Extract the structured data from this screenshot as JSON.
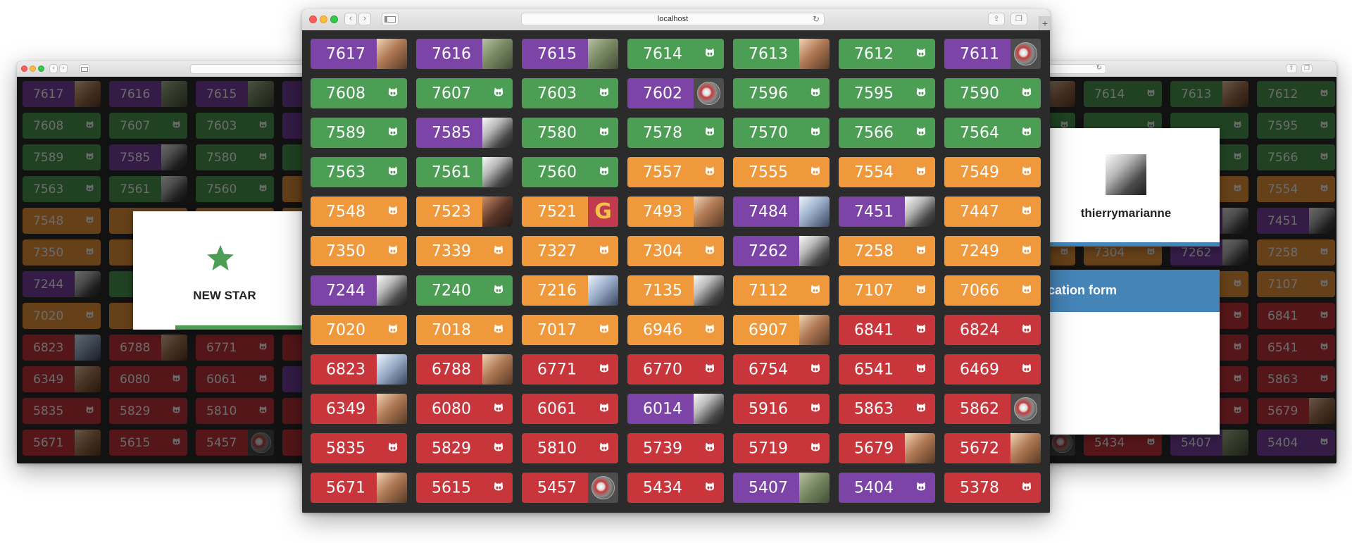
{
  "browser": {
    "url": "localhost"
  },
  "main_cards": [
    {
      "n": "7617",
      "c": "draft",
      "a": "f"
    },
    {
      "n": "7616",
      "c": "draft",
      "a": "g"
    },
    {
      "n": "7615",
      "c": "draft",
      "a": "g"
    },
    {
      "n": "7614",
      "c": "merged"
    },
    {
      "n": "7613",
      "c": "merged",
      "a": "f"
    },
    {
      "n": "7612",
      "c": "merged"
    },
    {
      "n": "7611",
      "c": "draft",
      "a": "r"
    },
    {
      "n": "7608",
      "c": "merged"
    },
    {
      "n": "7607",
      "c": "merged"
    },
    {
      "n": "7603",
      "c": "merged"
    },
    {
      "n": "7602",
      "c": "draft",
      "a": "r"
    },
    {
      "n": "7596",
      "c": "merged"
    },
    {
      "n": "7595",
      "c": "merged"
    },
    {
      "n": "7590",
      "c": "merged"
    },
    {
      "n": "7589",
      "c": "merged"
    },
    {
      "n": "7585",
      "c": "draft",
      "a": "b"
    },
    {
      "n": "7580",
      "c": "merged"
    },
    {
      "n": "7578",
      "c": "merged"
    },
    {
      "n": "7570",
      "c": "merged"
    },
    {
      "n": "7566",
      "c": "merged"
    },
    {
      "n": "7564",
      "c": "merged"
    },
    {
      "n": "7563",
      "c": "merged"
    },
    {
      "n": "7561",
      "c": "merged",
      "a": "b"
    },
    {
      "n": "7560",
      "c": "merged"
    },
    {
      "n": "7557",
      "c": "open"
    },
    {
      "n": "7555",
      "c": "open"
    },
    {
      "n": "7554",
      "c": "open"
    },
    {
      "n": "7549",
      "c": "open"
    },
    {
      "n": "7548",
      "c": "open"
    },
    {
      "n": "7523",
      "c": "open",
      "a": "k"
    },
    {
      "n": "7521",
      "c": "open",
      "a": "gg"
    },
    {
      "n": "7493",
      "c": "open",
      "a": "f"
    },
    {
      "n": "7484",
      "c": "draft",
      "a": "l"
    },
    {
      "n": "7451",
      "c": "draft",
      "a": "b"
    },
    {
      "n": "7447",
      "c": "open"
    },
    {
      "n": "7350",
      "c": "open"
    },
    {
      "n": "7339",
      "c": "open"
    },
    {
      "n": "7327",
      "c": "open"
    },
    {
      "n": "7304",
      "c": "open"
    },
    {
      "n": "7262",
      "c": "draft",
      "a": "b"
    },
    {
      "n": "7258",
      "c": "open"
    },
    {
      "n": "7249",
      "c": "open"
    },
    {
      "n": "7244",
      "c": "draft",
      "a": "b"
    },
    {
      "n": "7240",
      "c": "merged"
    },
    {
      "n": "7216",
      "c": "open",
      "a": "l"
    },
    {
      "n": "7135",
      "c": "open",
      "a": "b"
    },
    {
      "n": "7112",
      "c": "open"
    },
    {
      "n": "7107",
      "c": "open"
    },
    {
      "n": "7066",
      "c": "open"
    },
    {
      "n": "7020",
      "c": "open"
    },
    {
      "n": "7018",
      "c": "open"
    },
    {
      "n": "7017",
      "c": "open"
    },
    {
      "n": "6946",
      "c": "open"
    },
    {
      "n": "6907",
      "c": "open",
      "a": "f"
    },
    {
      "n": "6841",
      "c": "closed"
    },
    {
      "n": "6824",
      "c": "closed"
    },
    {
      "n": "6823",
      "c": "closed",
      "a": "l"
    },
    {
      "n": "6788",
      "c": "closed",
      "a": "f"
    },
    {
      "n": "6771",
      "c": "closed"
    },
    {
      "n": "6770",
      "c": "closed"
    },
    {
      "n": "6754",
      "c": "closed"
    },
    {
      "n": "6541",
      "c": "closed"
    },
    {
      "n": "6469",
      "c": "closed"
    },
    {
      "n": "6349",
      "c": "closed",
      "a": "f"
    },
    {
      "n": "6080",
      "c": "closed"
    },
    {
      "n": "6061",
      "c": "closed"
    },
    {
      "n": "6014",
      "c": "draft",
      "a": "b"
    },
    {
      "n": "5916",
      "c": "closed"
    },
    {
      "n": "5863",
      "c": "closed"
    },
    {
      "n": "5862",
      "c": "closed",
      "a": "r"
    },
    {
      "n": "5835",
      "c": "closed"
    },
    {
      "n": "5829",
      "c": "closed"
    },
    {
      "n": "5810",
      "c": "closed"
    },
    {
      "n": "5739",
      "c": "closed"
    },
    {
      "n": "5719",
      "c": "closed"
    },
    {
      "n": "5679",
      "c": "closed",
      "a": "f"
    },
    {
      "n": "5672",
      "c": "closed",
      "a": "f"
    },
    {
      "n": "5671",
      "c": "closed",
      "a": "f"
    },
    {
      "n": "5615",
      "c": "closed"
    },
    {
      "n": "5457",
      "c": "closed",
      "a": "r"
    },
    {
      "n": "5434",
      "c": "closed"
    },
    {
      "n": "5407",
      "c": "draft",
      "a": "g"
    },
    {
      "n": "5404",
      "c": "draft"
    },
    {
      "n": "5378",
      "c": "closed"
    }
  ],
  "left_cards": [
    {
      "n": "7617",
      "c": "draft",
      "a": "f"
    },
    {
      "n": "7616",
      "c": "draft",
      "a": "g"
    },
    {
      "n": "7615",
      "c": "draft",
      "a": "g"
    },
    {
      "n": "",
      "c": "draft"
    },
    {
      "n": "7608",
      "c": "merged"
    },
    {
      "n": "7607",
      "c": "merged"
    },
    {
      "n": "7603",
      "c": "merged"
    },
    {
      "n": "",
      "c": "draft"
    },
    {
      "n": "7589",
      "c": "merged"
    },
    {
      "n": "7585",
      "c": "draft",
      "a": "b"
    },
    {
      "n": "7580",
      "c": "merged"
    },
    {
      "n": "",
      "c": "merged"
    },
    {
      "n": "7563",
      "c": "merged"
    },
    {
      "n": "7561",
      "c": "merged",
      "a": "b"
    },
    {
      "n": "7560",
      "c": "merged"
    },
    {
      "n": "",
      "c": "open"
    },
    {
      "n": "7548",
      "c": "open"
    },
    {
      "n": "",
      "c": "open"
    },
    {
      "n": "",
      "c": "open"
    },
    {
      "n": "",
      "c": "open"
    },
    {
      "n": "7350",
      "c": "open"
    },
    {
      "n": "",
      "c": "open"
    },
    {
      "n": "",
      "c": "open"
    },
    {
      "n": "",
      "c": "open"
    },
    {
      "n": "7244",
      "c": "draft",
      "a": "b"
    },
    {
      "n": "",
      "c": "merged"
    },
    {
      "n": "",
      "c": "open"
    },
    {
      "n": "",
      "c": "open"
    },
    {
      "n": "7020",
      "c": "open"
    },
    {
      "n": "",
      "c": "open"
    },
    {
      "n": "",
      "c": "open"
    },
    {
      "n": "",
      "c": "open"
    },
    {
      "n": "6823",
      "c": "closed",
      "a": "l"
    },
    {
      "n": "6788",
      "c": "closed",
      "a": "f"
    },
    {
      "n": "6771",
      "c": "closed"
    },
    {
      "n": "",
      "c": "closed"
    },
    {
      "n": "6349",
      "c": "closed",
      "a": "f"
    },
    {
      "n": "6080",
      "c": "closed"
    },
    {
      "n": "6061",
      "c": "closed"
    },
    {
      "n": "",
      "c": "draft"
    },
    {
      "n": "5835",
      "c": "closed"
    },
    {
      "n": "5829",
      "c": "closed"
    },
    {
      "n": "5810",
      "c": "closed"
    },
    {
      "n": "",
      "c": "closed"
    },
    {
      "n": "5671",
      "c": "closed",
      "a": "f"
    },
    {
      "n": "5615",
      "c": "closed"
    },
    {
      "n": "5457",
      "c": "closed",
      "a": "r"
    },
    {
      "n": "",
      "c": "closed"
    }
  ],
  "right_cards": [
    {
      "n": "",
      "c": "merged",
      "a": "f"
    },
    {
      "n": "7614",
      "c": "merged"
    },
    {
      "n": "7613",
      "c": "merged",
      "a": "f"
    },
    {
      "n": "7612",
      "c": "merged"
    },
    {
      "n": "",
      "c": "merged"
    },
    {
      "n": "",
      "c": "merged"
    },
    {
      "n": "",
      "c": "merged"
    },
    {
      "n": "7595",
      "c": "merged"
    },
    {
      "n": "",
      "c": "merged"
    },
    {
      "n": "",
      "c": "merged"
    },
    {
      "n": "",
      "c": "merged"
    },
    {
      "n": "7566",
      "c": "merged"
    },
    {
      "n": "",
      "c": "open"
    },
    {
      "n": "",
      "c": "open"
    },
    {
      "n": "",
      "c": "open"
    },
    {
      "n": "7554",
      "c": "open"
    },
    {
      "n": "",
      "c": "draft",
      "a": "b"
    },
    {
      "n": "",
      "c": "open"
    },
    {
      "n": "",
      "c": "draft",
      "a": "b"
    },
    {
      "n": "7451",
      "c": "draft",
      "a": "b"
    },
    {
      "n": "",
      "c": "open"
    },
    {
      "n": "7304",
      "c": "open"
    },
    {
      "n": "7262",
      "c": "draft",
      "a": "b"
    },
    {
      "n": "7258",
      "c": "open"
    },
    {
      "n": "",
      "c": "open"
    },
    {
      "n": "",
      "c": "open"
    },
    {
      "n": "",
      "c": "open"
    },
    {
      "n": "7107",
      "c": "open"
    },
    {
      "n": "",
      "c": "open",
      "a": "f"
    },
    {
      "n": "",
      "c": "closed"
    },
    {
      "n": "",
      "c": "closed"
    },
    {
      "n": "6841",
      "c": "closed"
    },
    {
      "n": "",
      "c": "closed"
    },
    {
      "n": "",
      "c": "closed"
    },
    {
      "n": "",
      "c": "closed"
    },
    {
      "n": "6541",
      "c": "closed"
    },
    {
      "n": "",
      "c": "closed",
      "a": "b"
    },
    {
      "n": "",
      "c": "closed"
    },
    {
      "n": "",
      "c": "closed"
    },
    {
      "n": "5863",
      "c": "closed"
    },
    {
      "n": "",
      "c": "closed"
    },
    {
      "n": "",
      "c": "closed"
    },
    {
      "n": "",
      "c": "closed"
    },
    {
      "n": "5679",
      "c": "closed",
      "a": "f"
    },
    {
      "n": "",
      "c": "closed",
      "a": "r"
    },
    {
      "n": "5434",
      "c": "closed"
    },
    {
      "n": "5407",
      "c": "draft",
      "a": "g"
    },
    {
      "n": "5404",
      "c": "draft"
    }
  ],
  "notifications": {
    "new_star": {
      "label": "NEW STAR",
      "icon": "star-icon",
      "color": "#4c9e55"
    },
    "user": {
      "username": "thierrymarianne",
      "bar_color": "#4584b7"
    },
    "pr_title": "uthentication form"
  },
  "colors": {
    "merged": "#4c9e55",
    "open": "#f0993c",
    "closed": "#c8363c",
    "draft": "#7d44a7",
    "background": "#2b2b2b"
  }
}
